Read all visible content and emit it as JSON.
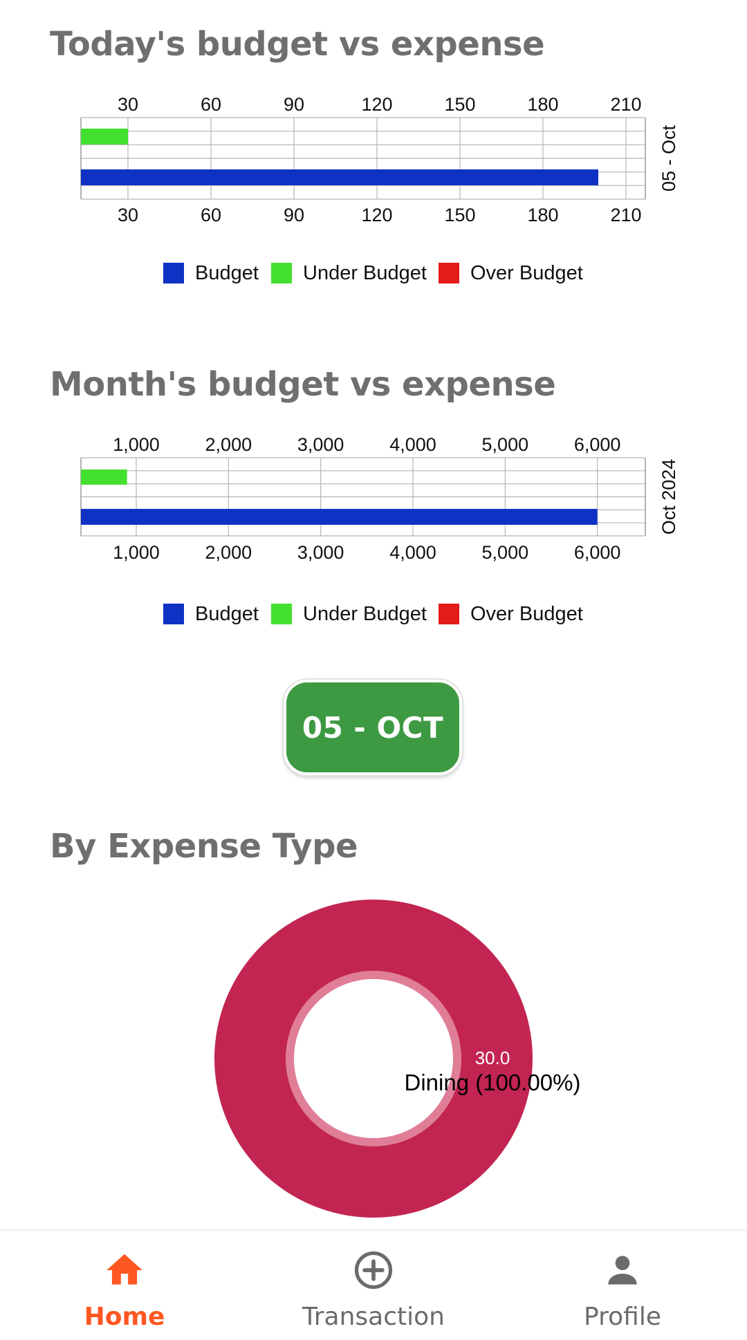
{
  "today_chart": {
    "title": "Today's budget vs expense",
    "period_label": "05 - Oct",
    "chart_data": {
      "type": "bar",
      "orientation": "horizontal",
      "series": [
        {
          "name": "Under Budget",
          "values": [
            30
          ],
          "color": "#44e030"
        },
        {
          "name": "Budget",
          "values": [
            200
          ],
          "color": "#0f32c4"
        }
      ],
      "xlim": [
        13,
        217
      ],
      "ticks": [
        30,
        60,
        90,
        120,
        150,
        180,
        210
      ],
      "tick_labels": [
        "30",
        "60",
        "90",
        "120",
        "150",
        "180",
        "210"
      ]
    }
  },
  "month_chart": {
    "title": "Month's budget vs expense",
    "period_label": "Oct 2024",
    "chart_data": {
      "type": "bar",
      "orientation": "horizontal",
      "series": [
        {
          "name": "Under Budget",
          "values": [
            900
          ],
          "color": "#44e030"
        },
        {
          "name": "Budget",
          "values": [
            6000
          ],
          "color": "#0f32c4"
        }
      ],
      "xlim": [
        400,
        6520
      ],
      "ticks": [
        1000,
        2000,
        3000,
        4000,
        5000,
        6000
      ],
      "tick_labels": [
        "1,000",
        "2,000",
        "3,000",
        "4,000",
        "5,000",
        "6,000"
      ]
    }
  },
  "legend": [
    {
      "label": "Budget",
      "color": "#0f32c4"
    },
    {
      "label": "Under Budget",
      "color": "#44e030"
    },
    {
      "label": "Over Budget",
      "color": "#e31b1b"
    }
  ],
  "date_button": {
    "label": "05 - OCT"
  },
  "expense_type": {
    "title": "By Expense Type",
    "chart_data": {
      "type": "pie",
      "variant": "donut",
      "slices": [
        {
          "label": "Dining",
          "value": 30.0,
          "value_label": "30.0",
          "percent_label": "Dining (100.00%)",
          "color": "#c22552"
        }
      ]
    }
  },
  "nav": {
    "items": [
      {
        "label": "Home",
        "icon": "home-icon",
        "active": true
      },
      {
        "label": "Transaction",
        "icon": "add-circle-icon",
        "active": false
      },
      {
        "label": "Profile",
        "icon": "person-icon",
        "active": false
      }
    ],
    "active_color": "#ff5722",
    "inactive_color": "#6b6b6b"
  }
}
